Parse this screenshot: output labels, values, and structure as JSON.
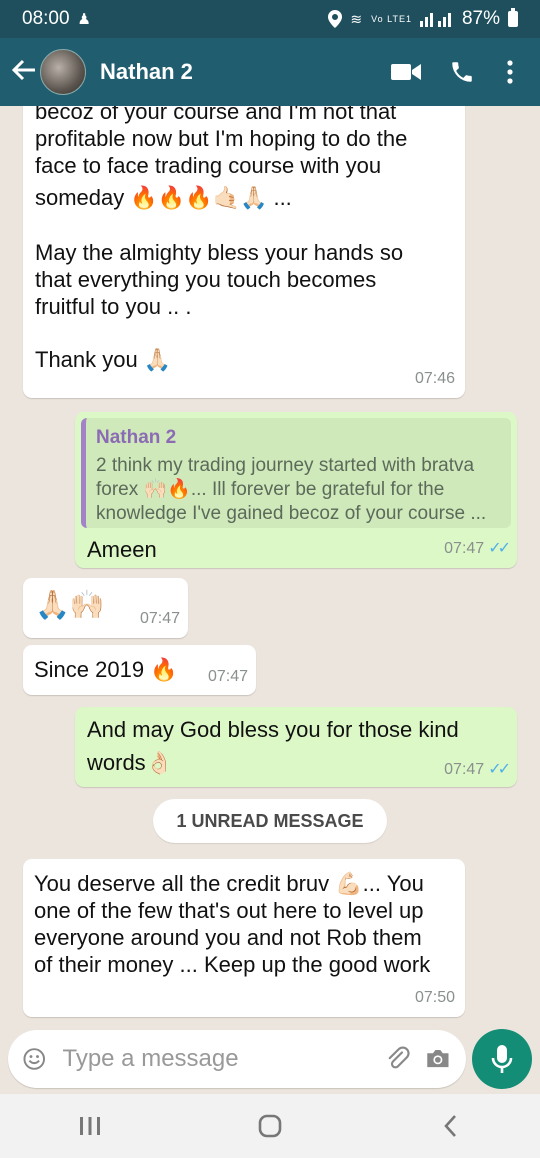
{
  "status": {
    "time": "08:00",
    "battery": "87%",
    "network": "Vo LTE1"
  },
  "header": {
    "contact_name": "Nathan 2"
  },
  "messages": {
    "m1": {
      "p1a": "becoz of your course and I'm not that",
      "p1b": "profitable now but I'm hoping to do the",
      "p1c": "face to face trading course with you",
      "p1d": "someday 🔥🔥🔥🤙🏻🙏🏻 ...",
      "p2a": "May the almighty bless your hands so",
      "p2b": "that everything you touch becomes",
      "p2c": "fruitful to you .. .",
      "p3": "Thank you 🙏🏻",
      "time": "07:46"
    },
    "m2": {
      "quote_name": "Nathan 2",
      "quote_l1": "2 think my trading journey started with bratva",
      "quote_l2": "forex 🙌🏻🔥... Ill forever be grateful for the",
      "quote_l3": "knowledge I've gained becoz of your course ...",
      "text": "Ameen",
      "time": "07:47"
    },
    "m3": {
      "text": "🙏🏻🙌🏻",
      "time": "07:47"
    },
    "m4": {
      "text": "Since 2019 🔥",
      "time": "07:47"
    },
    "m5": {
      "l1": "And may God bless you for those kind",
      "l2": "words👌🏻",
      "time": "07:47"
    },
    "unread": "1 UNREAD MESSAGE",
    "m6": {
      "l1": "You deserve all the credit bruv 💪🏻... You",
      "l2": "one of the few that's out here to level up",
      "l3": "everyone around you and not Rob them",
      "l4": "of their money ... Keep up the good work",
      "time": "07:50"
    }
  },
  "input": {
    "placeholder": "Type a message"
  },
  "colors": {
    "header": "#205e6f",
    "status_bar": "#1f4f5d",
    "outgoing": "#dcf8c6",
    "accent": "#138d75",
    "ticks": "#4fb0e9"
  }
}
